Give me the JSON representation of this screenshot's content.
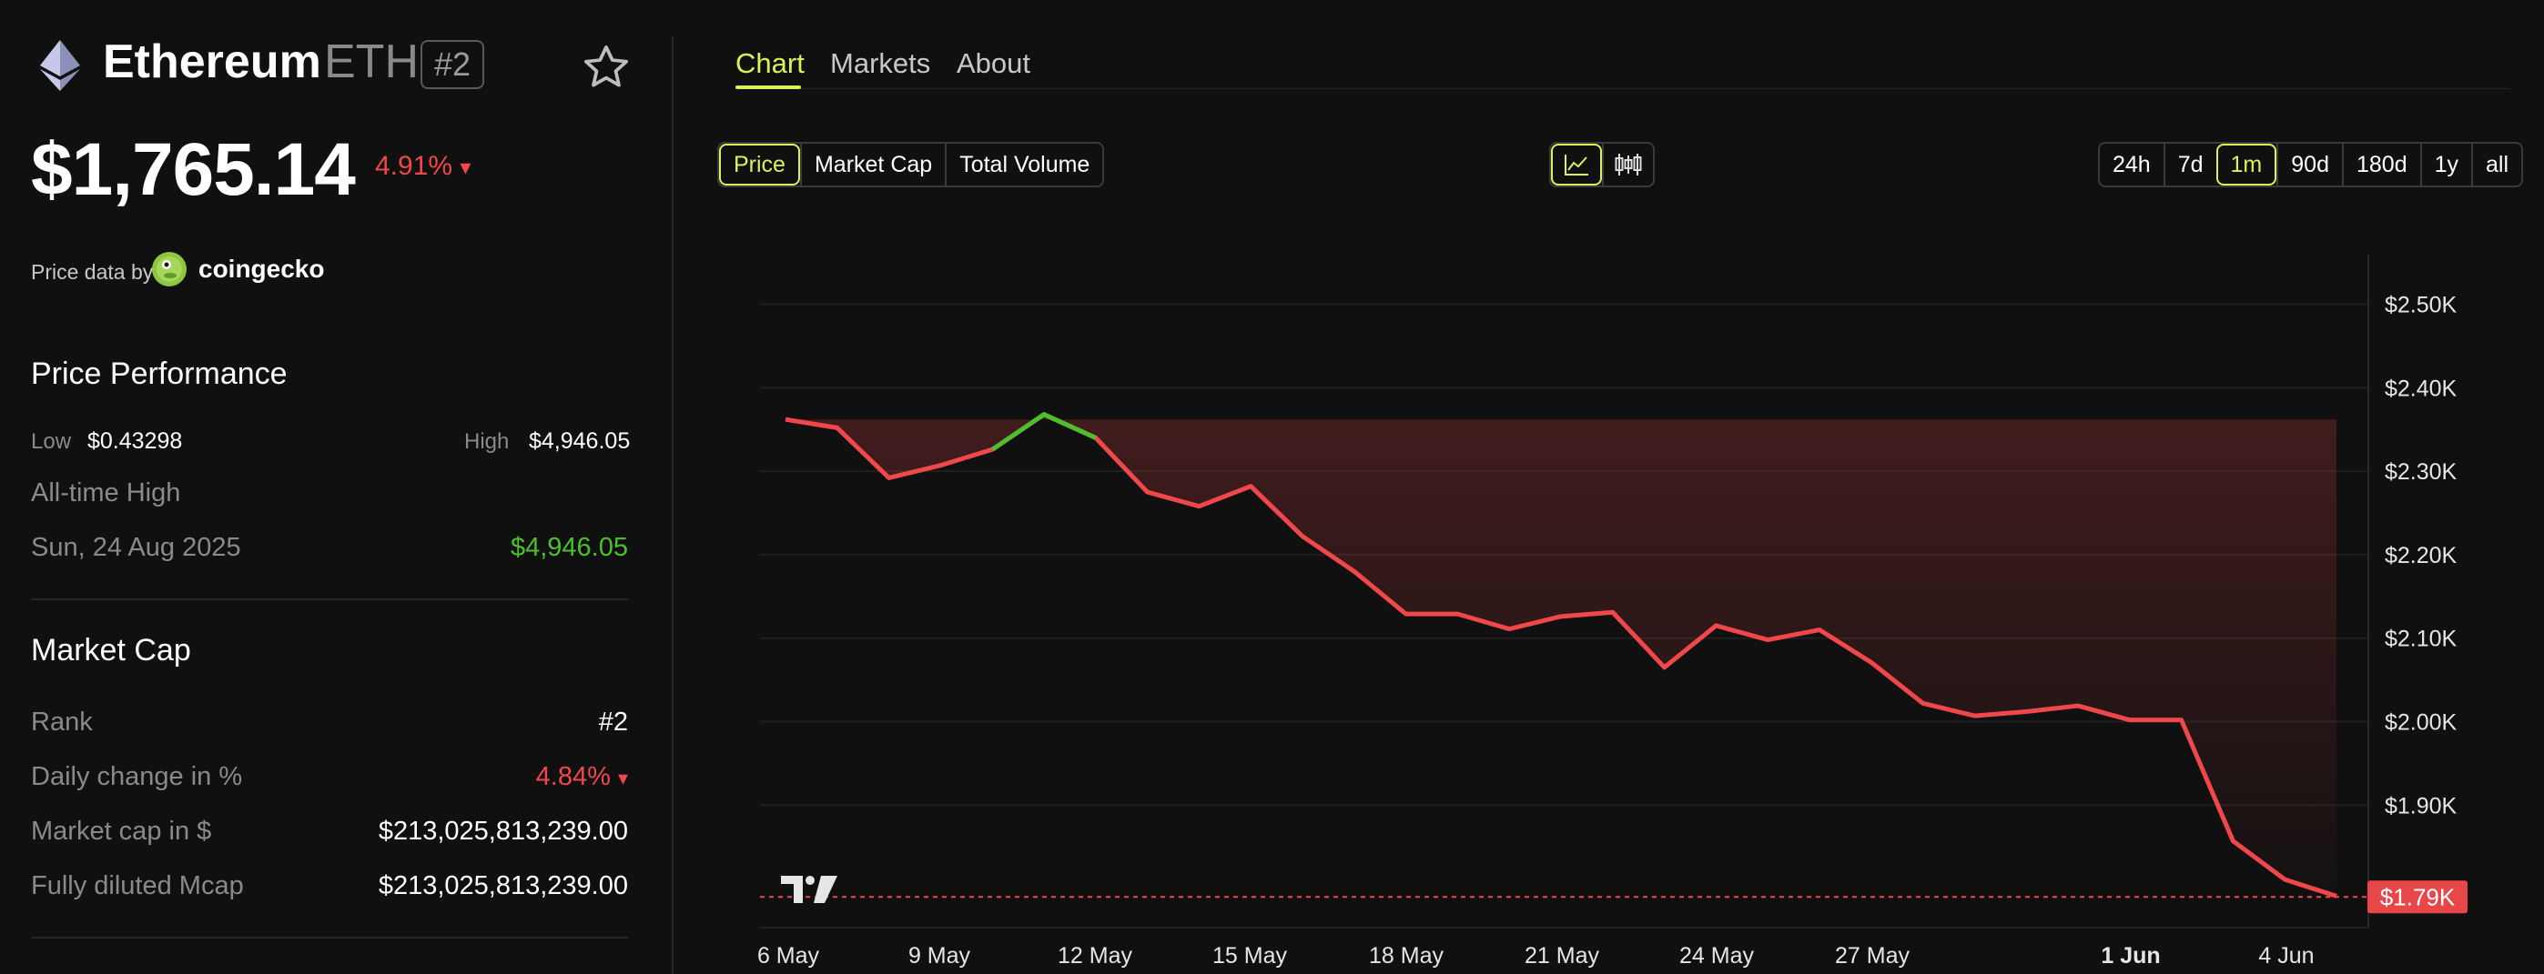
{
  "coin": {
    "name": "Ethereum",
    "ticker": "ETH",
    "rank_badge": "#2",
    "price": "$1,765.14",
    "change": "4.91%",
    "change_arrow": "▾",
    "price_data_label": "Price data by",
    "provider": "coingecko"
  },
  "performance": {
    "title": "Price Performance",
    "low_label": "Low",
    "low_value": "$0.43298",
    "high_label": "High",
    "high_value": "$4,946.05",
    "ath_label": "All-time High",
    "ath_date": "Sun, 24 Aug 2025",
    "ath_value": "$4,946.05"
  },
  "market_cap": {
    "title": "Market Cap",
    "rank_label": "Rank",
    "rank_value": "#2",
    "daily_label": "Daily change in %",
    "daily_value": "4.84%",
    "daily_arrow": "▾",
    "mcap_label": "Market cap in $",
    "mcap_value": "$213,025,813,239.00",
    "fdv_label": "Fully diluted Mcap",
    "fdv_value": "$213,025,813,239.00"
  },
  "tabs": [
    {
      "label": "Chart",
      "active": true
    },
    {
      "label": "Markets",
      "active": false
    },
    {
      "label": "About",
      "active": false
    }
  ],
  "metric_options": [
    "Price",
    "Market Cap",
    "Total Volume"
  ],
  "chart_type_icons": [
    "line-chart-icon",
    "candlestick-icon"
  ],
  "ranges": [
    "24h",
    "7d",
    "1m",
    "90d",
    "180d",
    "1y",
    "all"
  ],
  "active_range": "1m",
  "colors": {
    "accent": "#d8f35a",
    "down": "#f0474a",
    "up": "#4cbf2c",
    "background": "#101010"
  },
  "chart_data": {
    "type": "line",
    "x_ticks": [
      "6 May",
      "9 May",
      "12 May",
      "15 May",
      "18 May",
      "21 May",
      "24 May",
      "27 May",
      "1 Jun",
      "4 Jun"
    ],
    "y_ticks": [
      "$2.50K",
      "$2.40K",
      "$2.30K",
      "$2.20K",
      "$2.10K",
      "$2.00K",
      "$1.90K"
    ],
    "ylim": [
      1.75,
      2.53
    ],
    "current_label": "$1.79K",
    "current_value": 1.79,
    "grid": true,
    "series": [
      {
        "values": [
          2.362,
          2.352,
          2.292,
          2.307,
          2.326,
          2.368,
          2.34,
          2.275,
          2.258,
          2.282,
          2.222,
          2.18,
          2.129,
          2.129,
          2.111,
          2.126,
          2.131,
          2.065,
          2.115,
          2.098,
          2.11,
          2.071,
          2.022,
          2.007,
          2.012,
          2.019,
          2.002,
          2.002,
          1.857,
          1.811,
          1.791
        ]
      }
    ]
  }
}
